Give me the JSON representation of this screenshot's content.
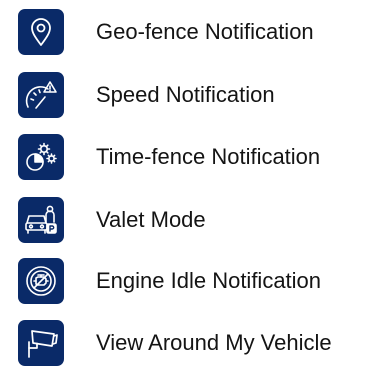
{
  "colors": {
    "icon_tile": "#0a2a68",
    "icon_stroke": "#ffffff",
    "text": "#141414"
  },
  "items": [
    {
      "label": "Geo-fence Notification",
      "icon": "map-pin-icon"
    },
    {
      "label": "Speed Notification",
      "icon": "speedometer-warning-icon"
    },
    {
      "label": "Time-fence Notification",
      "icon": "clock-gears-icon"
    },
    {
      "label": "Valet Mode",
      "icon": "valet-car-parking-icon"
    },
    {
      "label": "Engine Idle Notification",
      "icon": "engine-idle-icon"
    },
    {
      "label": "View Around My Vehicle",
      "icon": "camera-icon"
    }
  ]
}
